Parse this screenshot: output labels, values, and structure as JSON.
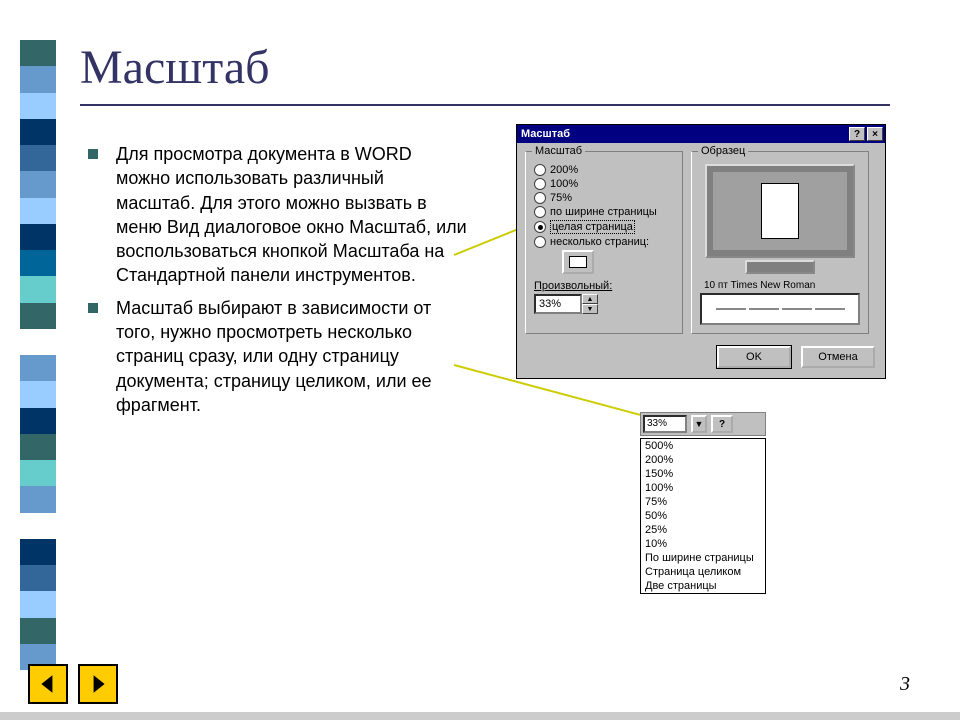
{
  "title": "Масштаб",
  "bullets": [
    "Для просмотра документа в WORD можно использовать различный масштаб. Для этого можно вызвать в меню Вид диалоговое окно Масштаб, или воспользоваться кнопкой Масштаба на Стандартной панели инструментов.",
    "Масштаб выбирают в зависимости от того, нужно просмотреть несколько страниц сразу, или одну страницу документа; страницу целиком, или ее фрагмент."
  ],
  "dialog": {
    "title": "Масштаб",
    "help_btn": "?",
    "close_btn": "×",
    "group_zoom_title": "Масштаб",
    "radios": {
      "r200": "200%",
      "r100": "100%",
      "r75": "75%",
      "page_width": "по ширине страницы",
      "whole_page": "целая страница",
      "multi_pages": "несколько страниц:"
    },
    "custom_label": "Произвольный:",
    "custom_value": "33%",
    "group_sample_title": "Образец",
    "sample_font": "10 пт Times New Roman",
    "ok": "OK",
    "cancel": "Отмена"
  },
  "toolbar": {
    "zoom_value": "33%",
    "help": "?",
    "options": [
      "500%",
      "200%",
      "150%",
      "100%",
      "75%",
      "50%",
      "25%",
      "10%",
      "По ширине страницы",
      "Страница целиком",
      "Две страницы"
    ]
  },
  "page_number": "3",
  "stripe_colors": [
    "#336666",
    "#6699cc",
    "#99ccff",
    "#003366",
    "#336699",
    "#6699cc",
    "#99ccff",
    "#003366",
    "#006699",
    "#66cccc",
    "#336666",
    "#ffffff",
    "#6699cc",
    "#99ccff",
    "#003366",
    "#336666",
    "#66cccc",
    "#6699cc",
    "#ffffff",
    "#003366",
    "#336699",
    "#99ccff",
    "#336666",
    "#6699cc"
  ]
}
